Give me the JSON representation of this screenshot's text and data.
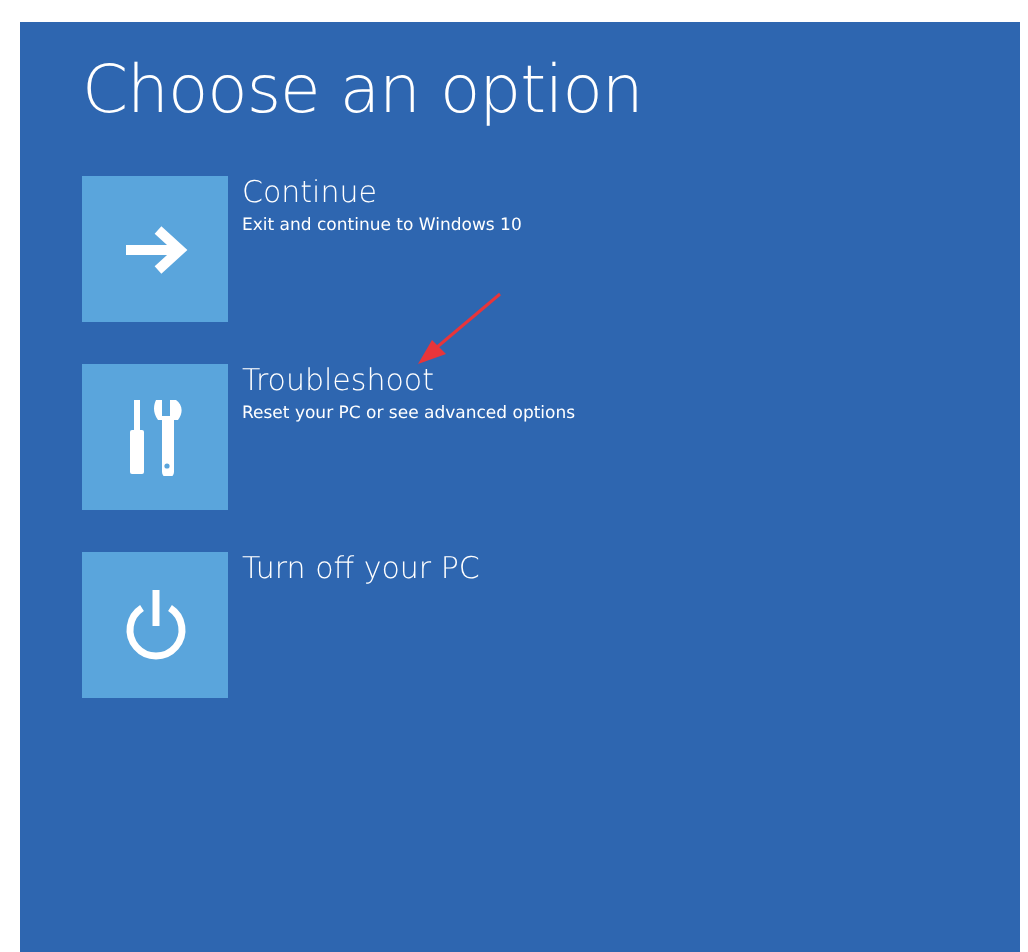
{
  "title": "Choose an option",
  "options": [
    {
      "kind": "continue",
      "title": "Continue",
      "description": "Exit and continue to Windows 10"
    },
    {
      "kind": "troubleshoot",
      "title": "Troubleshoot",
      "description": "Reset your PC or see advanced options"
    },
    {
      "kind": "power",
      "title": "Turn off your PC"
    }
  ]
}
